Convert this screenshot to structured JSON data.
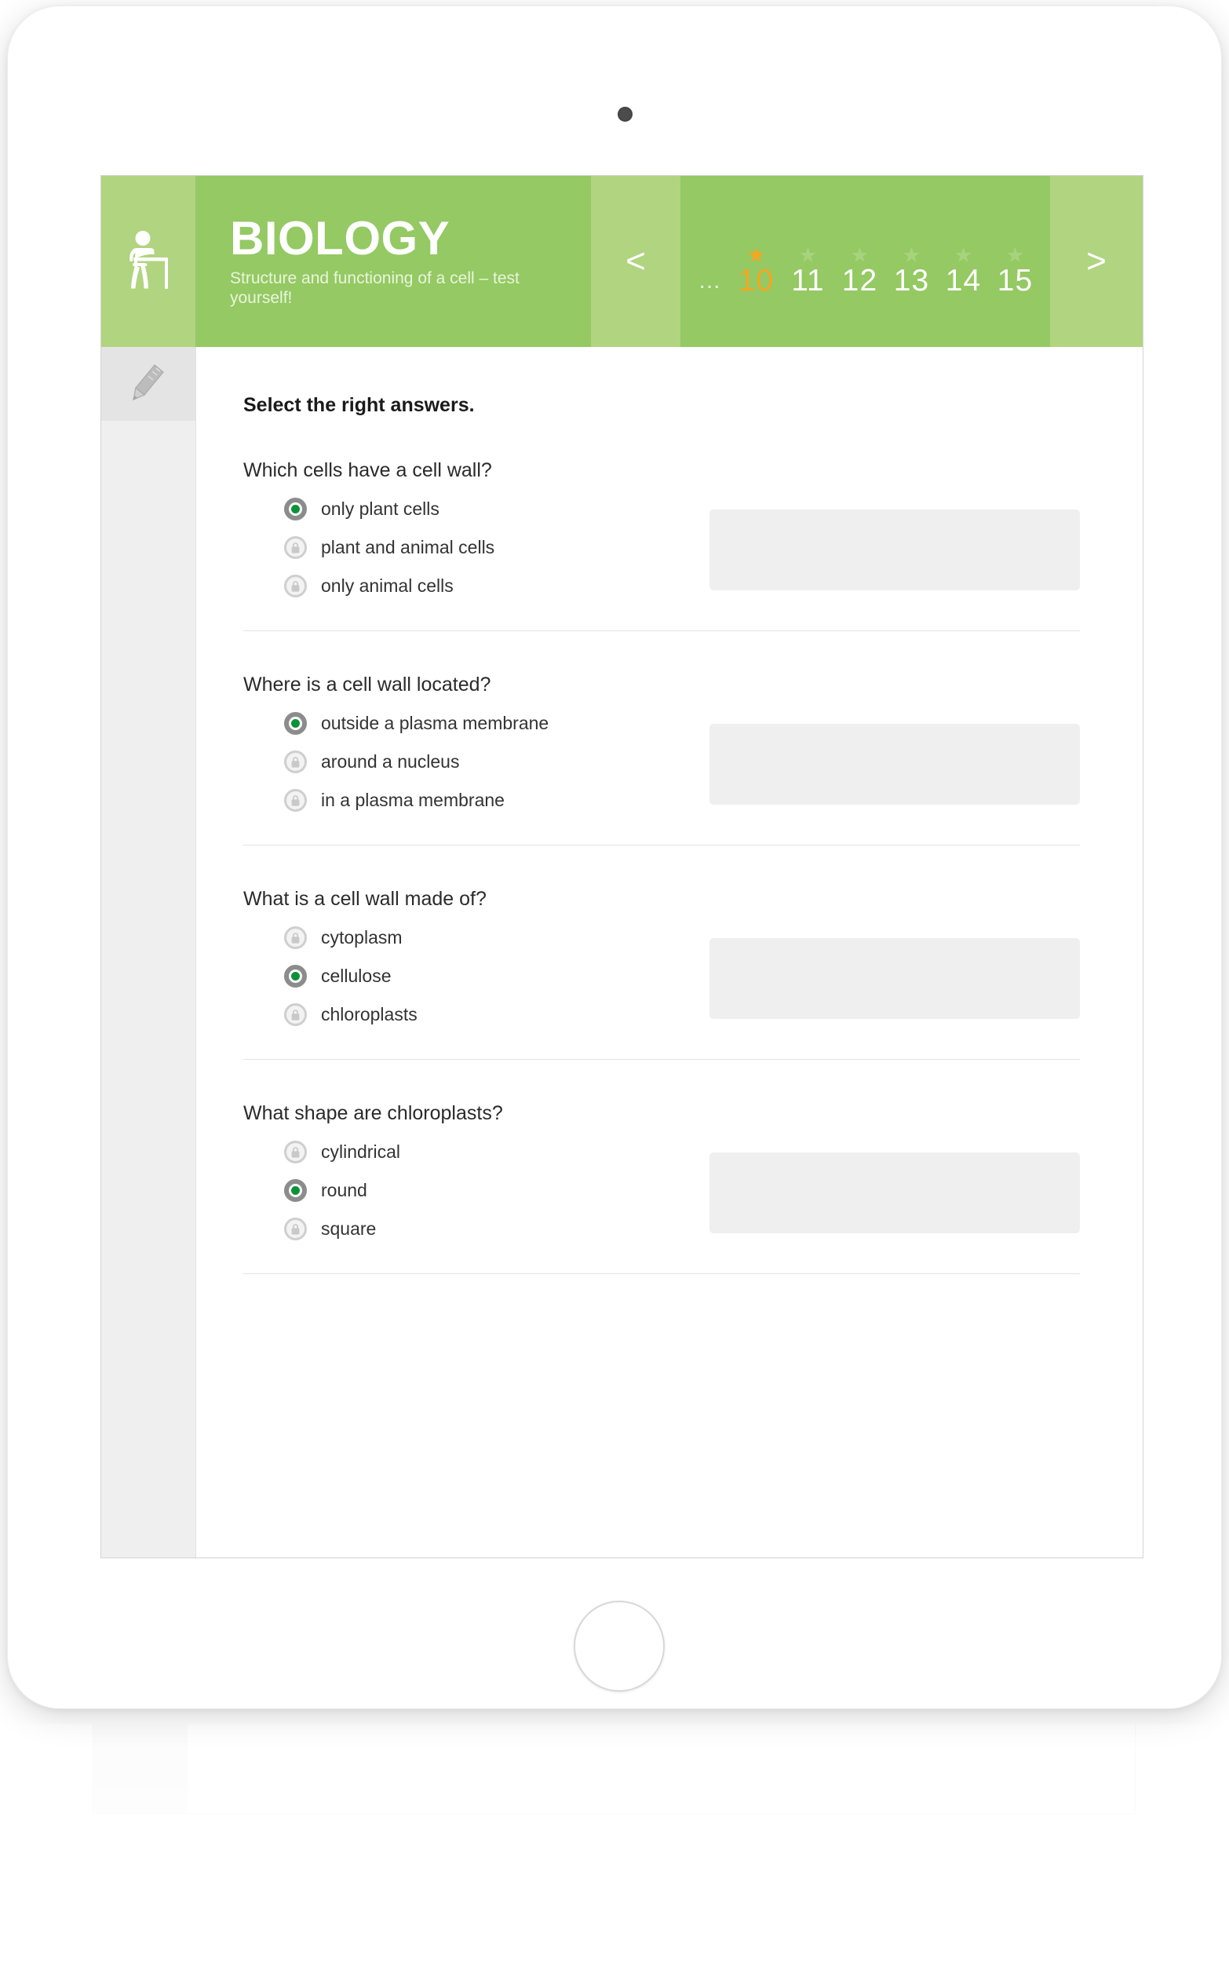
{
  "header": {
    "subject_icon": "student-at-desk-icon",
    "title": "BIOLOGY",
    "subtitle": "Structure and functioning of a cell – test yourself!",
    "prev_label": "<",
    "next_label": ">",
    "ellipsis": "...",
    "active_color": "#f5a623",
    "bar_color": "#94c963",
    "bar_color_light": "#b1d480",
    "pages": [
      {
        "number": "10",
        "active": true
      },
      {
        "number": "11",
        "active": false
      },
      {
        "number": "12",
        "active": false
      },
      {
        "number": "13",
        "active": false
      },
      {
        "number": "14",
        "active": false
      },
      {
        "number": "15",
        "active": false
      }
    ]
  },
  "sidebar": {
    "tool_icon": "pencil-icon"
  },
  "content": {
    "prompt": "Select the right answers.",
    "selected_color": "#0b9137",
    "locked_icon": "lock-icon",
    "questions": [
      {
        "title": "Which cells have a cell wall?",
        "options": [
          {
            "label": "only plant cells",
            "state": "selected"
          },
          {
            "label": "plant and animal cells",
            "state": "locked"
          },
          {
            "label": "only animal cells",
            "state": "locked"
          }
        ]
      },
      {
        "title": "Where is a cell wall located?",
        "options": [
          {
            "label": "outside a plasma membrane",
            "state": "selected"
          },
          {
            "label": "around a nucleus",
            "state": "locked"
          },
          {
            "label": "in a plasma membrane",
            "state": "locked"
          }
        ]
      },
      {
        "title": "What is a cell wall made of?",
        "options": [
          {
            "label": "cytoplasm",
            "state": "locked"
          },
          {
            "label": "cellulose",
            "state": "selected"
          },
          {
            "label": "chloroplasts",
            "state": "locked"
          }
        ]
      },
      {
        "title": "What shape are chloroplasts?",
        "options": [
          {
            "label": "cylindrical",
            "state": "locked"
          },
          {
            "label": "round",
            "state": "selected"
          },
          {
            "label": "square",
            "state": "locked"
          }
        ]
      }
    ]
  },
  "device": {
    "camera": "front-camera-dot",
    "home_button": "home-button"
  }
}
